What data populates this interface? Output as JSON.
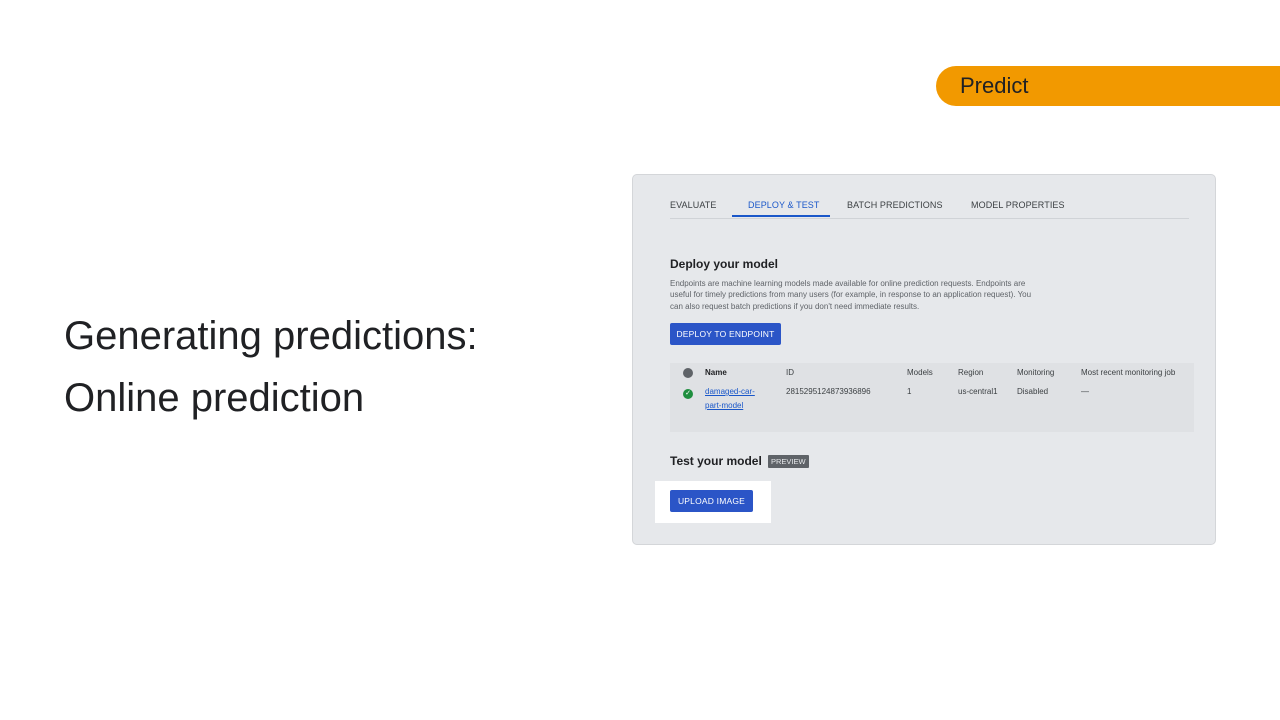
{
  "tag": {
    "label": "Predict"
  },
  "heading": {
    "line1": "Generating predictions:",
    "line2": "Online prediction"
  },
  "tabs": [
    {
      "label": "EVALUATE"
    },
    {
      "label": "DEPLOY & TEST"
    },
    {
      "label": "BATCH PREDICTIONS"
    },
    {
      "label": "MODEL PROPERTIES"
    }
  ],
  "deploy": {
    "title": "Deploy your model",
    "description": "Endpoints are machine learning models made available for online prediction requests. Endpoints are useful for timely predictions from many users (for example, in response to an application request). You can also request batch predictions if you don't need immediate results.",
    "button": "DEPLOY TO ENDPOINT"
  },
  "table": {
    "headers": [
      "Name",
      "ID",
      "Models",
      "Region",
      "Monitoring",
      "Most recent monitoring job"
    ],
    "row": {
      "name": "damaged-car-part-model",
      "id": "2815295124873936896",
      "models": "1",
      "region": "us-central1",
      "monitoring": "Disabled",
      "recent_job": "—"
    }
  },
  "test": {
    "title": "Test your model",
    "badge": "PREVIEW",
    "button": "UPLOAD IMAGE"
  },
  "colors": {
    "accent": "#2b55c7",
    "tag": "#f29900",
    "status_ok": "#1e8e3e"
  }
}
